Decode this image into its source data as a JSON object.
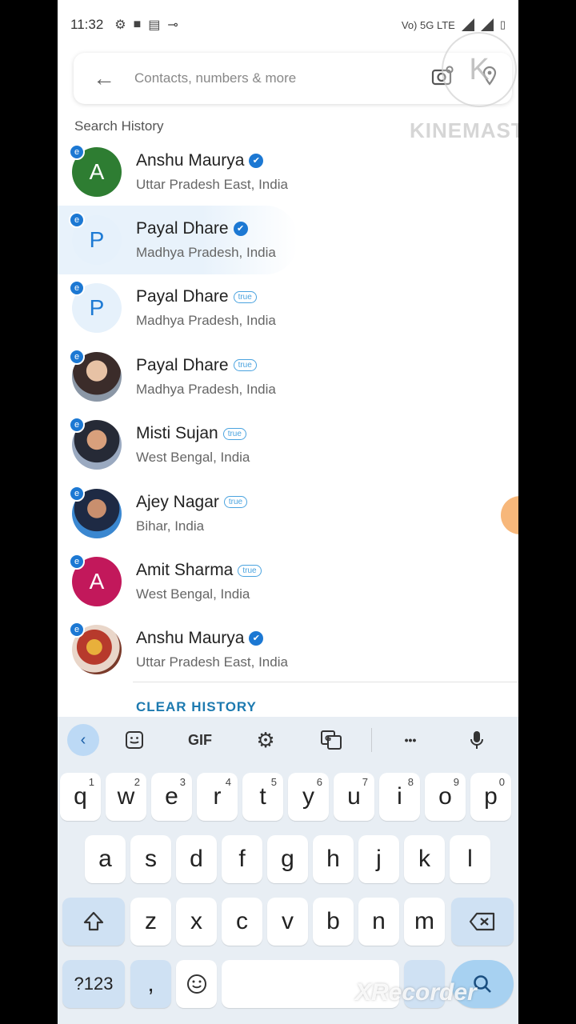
{
  "status_bar": {
    "time": "11:32",
    "left_icons": [
      "settings-icon",
      "video-icon",
      "card-icon",
      "key-icon"
    ],
    "right_text": "Vo) 5G LTE"
  },
  "search": {
    "placeholder": "Contacts, numbers & more"
  },
  "watermarks": {
    "kinemaster_letter": "K",
    "kinemaster": "KINEMASTER",
    "xrecorder": "XRecorder"
  },
  "history": {
    "title": "Search History",
    "items": [
      {
        "initial": "A",
        "name": "Anshu Maurya",
        "location": "Uttar Pradesh East, India",
        "badge": "verified",
        "avatar": "green"
      },
      {
        "initial": "P",
        "name": "Payal Dhare",
        "location": "Madhya Pradesh, India",
        "badge": "verified",
        "avatar": "light",
        "highlighted": true
      },
      {
        "initial": "P",
        "name": "Payal Dhare",
        "location": "Madhya Pradesh, India",
        "badge": "true",
        "avatar": "light"
      },
      {
        "initial": "",
        "name": "Payal Dhare",
        "location": "Madhya Pradesh, India",
        "badge": "true",
        "avatar": "photo"
      },
      {
        "initial": "",
        "name": "Misti Sujan",
        "location": "West Bengal, India",
        "badge": "true",
        "avatar": "photo2"
      },
      {
        "initial": "",
        "name": "Ajey Nagar",
        "location": "Bihar, India",
        "badge": "true",
        "avatar": "photo3"
      },
      {
        "initial": "A",
        "name": "Amit Sharma",
        "location": "West Bengal, India",
        "badge": "true",
        "avatar": "pink"
      },
      {
        "initial": "",
        "name": "Anshu Maurya",
        "location": "Uttar Pradesh East, India",
        "badge": "verified",
        "avatar": "photo4"
      }
    ],
    "clear_label": "CLEAR HISTORY",
    "true_label": "true",
    "e_badge": "e",
    "verified_glyph": "✔"
  },
  "keyboard": {
    "toolbar": {
      "gif": "GIF",
      "more": "•••"
    },
    "row1": [
      {
        "k": "q",
        "n": "1"
      },
      {
        "k": "w",
        "n": "2"
      },
      {
        "k": "e",
        "n": "3"
      },
      {
        "k": "r",
        "n": "4"
      },
      {
        "k": "t",
        "n": "5"
      },
      {
        "k": "y",
        "n": "6"
      },
      {
        "k": "u",
        "n": "7"
      },
      {
        "k": "i",
        "n": "8"
      },
      {
        "k": "o",
        "n": "9"
      },
      {
        "k": "p",
        "n": "0"
      }
    ],
    "row2": [
      "a",
      "s",
      "d",
      "f",
      "g",
      "h",
      "j",
      "k",
      "l"
    ],
    "row3": [
      "z",
      "x",
      "c",
      "v",
      "b",
      "n",
      "m"
    ],
    "symbols": "?123",
    "comma": ","
  }
}
